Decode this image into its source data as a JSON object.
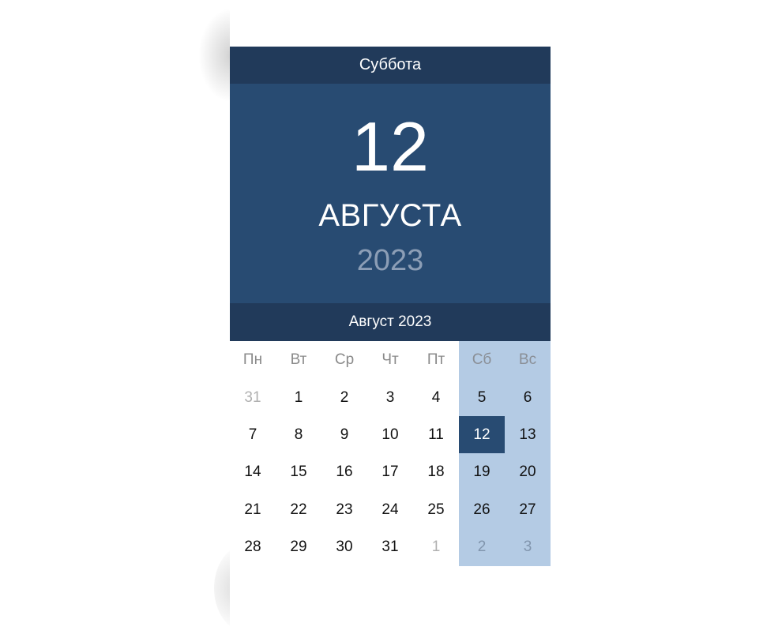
{
  "header": {
    "weekday": "Суббота"
  },
  "selected": {
    "day": "12",
    "month": "АВГУСТА",
    "year": "2023"
  },
  "calendar": {
    "title": "Август 2023",
    "weekdays": [
      "Пн",
      "Вт",
      "Ср",
      "Чт",
      "Пт",
      "Сб",
      "Вс"
    ],
    "weeks": [
      [
        {
          "d": "31",
          "other": true
        },
        {
          "d": "1"
        },
        {
          "d": "2"
        },
        {
          "d": "3"
        },
        {
          "d": "4"
        },
        {
          "d": "5"
        },
        {
          "d": "6"
        }
      ],
      [
        {
          "d": "7"
        },
        {
          "d": "8"
        },
        {
          "d": "9"
        },
        {
          "d": "10"
        },
        {
          "d": "11"
        },
        {
          "d": "12",
          "selected": true
        },
        {
          "d": "13"
        }
      ],
      [
        {
          "d": "14"
        },
        {
          "d": "15"
        },
        {
          "d": "16"
        },
        {
          "d": "17"
        },
        {
          "d": "18"
        },
        {
          "d": "19"
        },
        {
          "d": "20"
        }
      ],
      [
        {
          "d": "21"
        },
        {
          "d": "22"
        },
        {
          "d": "23"
        },
        {
          "d": "24"
        },
        {
          "d": "25"
        },
        {
          "d": "26"
        },
        {
          "d": "27"
        }
      ],
      [
        {
          "d": "28"
        },
        {
          "d": "29"
        },
        {
          "d": "30"
        },
        {
          "d": "31"
        },
        {
          "d": "1",
          "other": true
        },
        {
          "d": "2",
          "other": true
        },
        {
          "d": "3",
          "other": true
        }
      ]
    ]
  },
  "colors": {
    "header_dark": "#213a5a",
    "panel_blue": "#284b72",
    "weekend_bg": "#b4cbe4",
    "year_text": "#8c9eb6"
  }
}
